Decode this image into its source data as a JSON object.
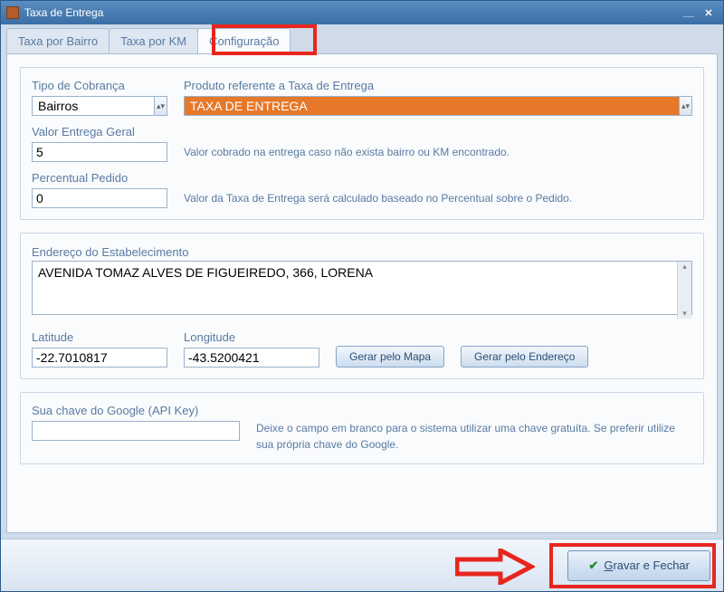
{
  "window": {
    "title": "Taxa de Entrega"
  },
  "tabs": {
    "bairro": "Taxa por Bairro",
    "km": "Taxa por KM",
    "config": "Configuração"
  },
  "config": {
    "tipoCobrancaLabel": "Tipo de Cobrança",
    "tipoCobrancaValue": "Bairros",
    "produtoLabel": "Produto referente a Taxa de Entrega",
    "produtoValue": "TAXA DE ENTREGA",
    "valorEntregaLabel": "Valor Entrega Geral",
    "valorEntregaValue": "5",
    "valorEntregaHelper": "Valor cobrado na entrega caso não exista bairro ou KM encontrado.",
    "percentualLabel": "Percentual Pedido",
    "percentualValue": "0",
    "percentualHelper": "Valor da Taxa de Entrega será calculado baseado no Percentual sobre o Pedido.",
    "enderecoLabel": "Endereço do Estabelecimento",
    "enderecoValue": "AVENIDA TOMAZ ALVES DE FIGUEIREDO, 366, LORENA",
    "latitudeLabel": "Latitude",
    "latitudeValue": "-22.7010817",
    "longitudeLabel": "Longitude",
    "longitudeValue": "-43.5200421",
    "gerarMapa": "Gerar pelo Mapa",
    "gerarEndereco": "Gerar pelo Endereço",
    "apiLabel": "Sua chave do Google (API Key)",
    "apiValue": "",
    "apiHelper": "Deixe o campo em branco para o sistema utilizar uma chave gratuíta. Se preferir utilize sua própria chave do Google."
  },
  "footer": {
    "saveLabel": "Gravar e Fechar"
  }
}
